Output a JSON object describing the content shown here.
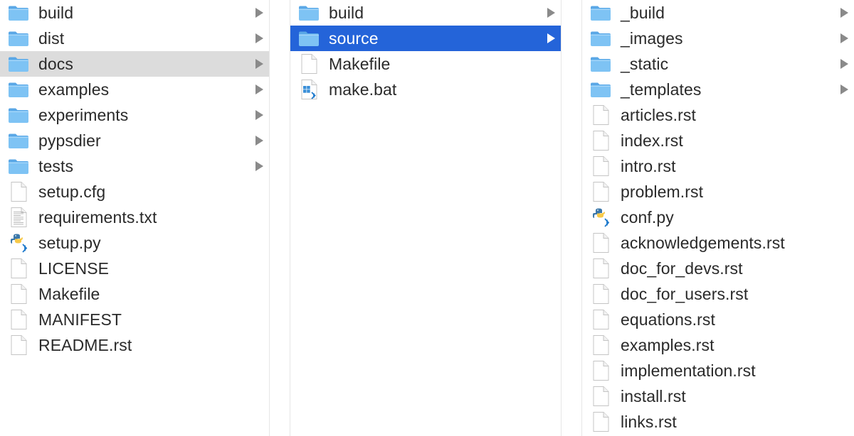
{
  "columns": [
    {
      "items": [
        {
          "label": "build",
          "type": "folder",
          "has_children": true,
          "state": "normal"
        },
        {
          "label": "dist",
          "type": "folder",
          "has_children": true,
          "state": "normal"
        },
        {
          "label": "docs",
          "type": "folder",
          "has_children": true,
          "state": "selected-inactive"
        },
        {
          "label": "examples",
          "type": "folder",
          "has_children": true,
          "state": "normal"
        },
        {
          "label": "experiments",
          "type": "folder",
          "has_children": true,
          "state": "normal"
        },
        {
          "label": "pypsdier",
          "type": "folder",
          "has_children": true,
          "state": "normal"
        },
        {
          "label": "tests",
          "type": "folder",
          "has_children": true,
          "state": "normal"
        },
        {
          "label": "setup.cfg",
          "type": "file",
          "has_children": false,
          "state": "normal"
        },
        {
          "label": "requirements.txt",
          "type": "text",
          "has_children": false,
          "state": "normal"
        },
        {
          "label": "setup.py",
          "type": "python",
          "has_children": false,
          "state": "normal"
        },
        {
          "label": "LICENSE",
          "type": "file",
          "has_children": false,
          "state": "normal"
        },
        {
          "label": "Makefile",
          "type": "file",
          "has_children": false,
          "state": "normal"
        },
        {
          "label": "MANIFEST",
          "type": "file",
          "has_children": false,
          "state": "normal"
        },
        {
          "label": "README.rst",
          "type": "file",
          "has_children": false,
          "state": "normal"
        }
      ]
    },
    {
      "items": [
        {
          "label": "build",
          "type": "folder",
          "has_children": true,
          "state": "normal"
        },
        {
          "label": "source",
          "type": "folder",
          "has_children": true,
          "state": "selected-active"
        },
        {
          "label": "Makefile",
          "type": "file",
          "has_children": false,
          "state": "normal"
        },
        {
          "label": "make.bat",
          "type": "bat",
          "has_children": false,
          "state": "normal"
        }
      ]
    },
    {
      "items": [
        {
          "label": "_build",
          "type": "folder",
          "has_children": true,
          "state": "normal"
        },
        {
          "label": "_images",
          "type": "folder",
          "has_children": true,
          "state": "normal"
        },
        {
          "label": "_static",
          "type": "folder",
          "has_children": true,
          "state": "normal"
        },
        {
          "label": "_templates",
          "type": "folder",
          "has_children": true,
          "state": "normal"
        },
        {
          "label": "articles.rst",
          "type": "file",
          "has_children": false,
          "state": "normal"
        },
        {
          "label": "index.rst",
          "type": "file",
          "has_children": false,
          "state": "normal"
        },
        {
          "label": "intro.rst",
          "type": "file",
          "has_children": false,
          "state": "normal"
        },
        {
          "label": "problem.rst",
          "type": "file",
          "has_children": false,
          "state": "normal"
        },
        {
          "label": "conf.py",
          "type": "python",
          "has_children": false,
          "state": "normal"
        },
        {
          "label": "acknowledgements.rst",
          "type": "file",
          "has_children": false,
          "state": "normal"
        },
        {
          "label": "doc_for_devs.rst",
          "type": "file",
          "has_children": false,
          "state": "normal"
        },
        {
          "label": "doc_for_users.rst",
          "type": "file",
          "has_children": false,
          "state": "normal"
        },
        {
          "label": "equations.rst",
          "type": "file",
          "has_children": false,
          "state": "normal"
        },
        {
          "label": "examples.rst",
          "type": "file",
          "has_children": false,
          "state": "normal"
        },
        {
          "label": "implementation.rst",
          "type": "file",
          "has_children": false,
          "state": "normal"
        },
        {
          "label": "install.rst",
          "type": "file",
          "has_children": false,
          "state": "normal"
        },
        {
          "label": "links.rst",
          "type": "file",
          "has_children": false,
          "state": "normal"
        }
      ]
    }
  ],
  "icon_names": {
    "folder": "folder-icon",
    "file": "document-icon",
    "text": "text-document-icon",
    "python": "python-file-icon",
    "bat": "windows-batch-file-icon"
  },
  "colors": {
    "selection_active": "#2464d9",
    "selection_inactive": "#dcdcdc",
    "folder_blue": "#7ec3f4",
    "text": "#2a2a2a",
    "chevron": "#8a8a8a"
  }
}
